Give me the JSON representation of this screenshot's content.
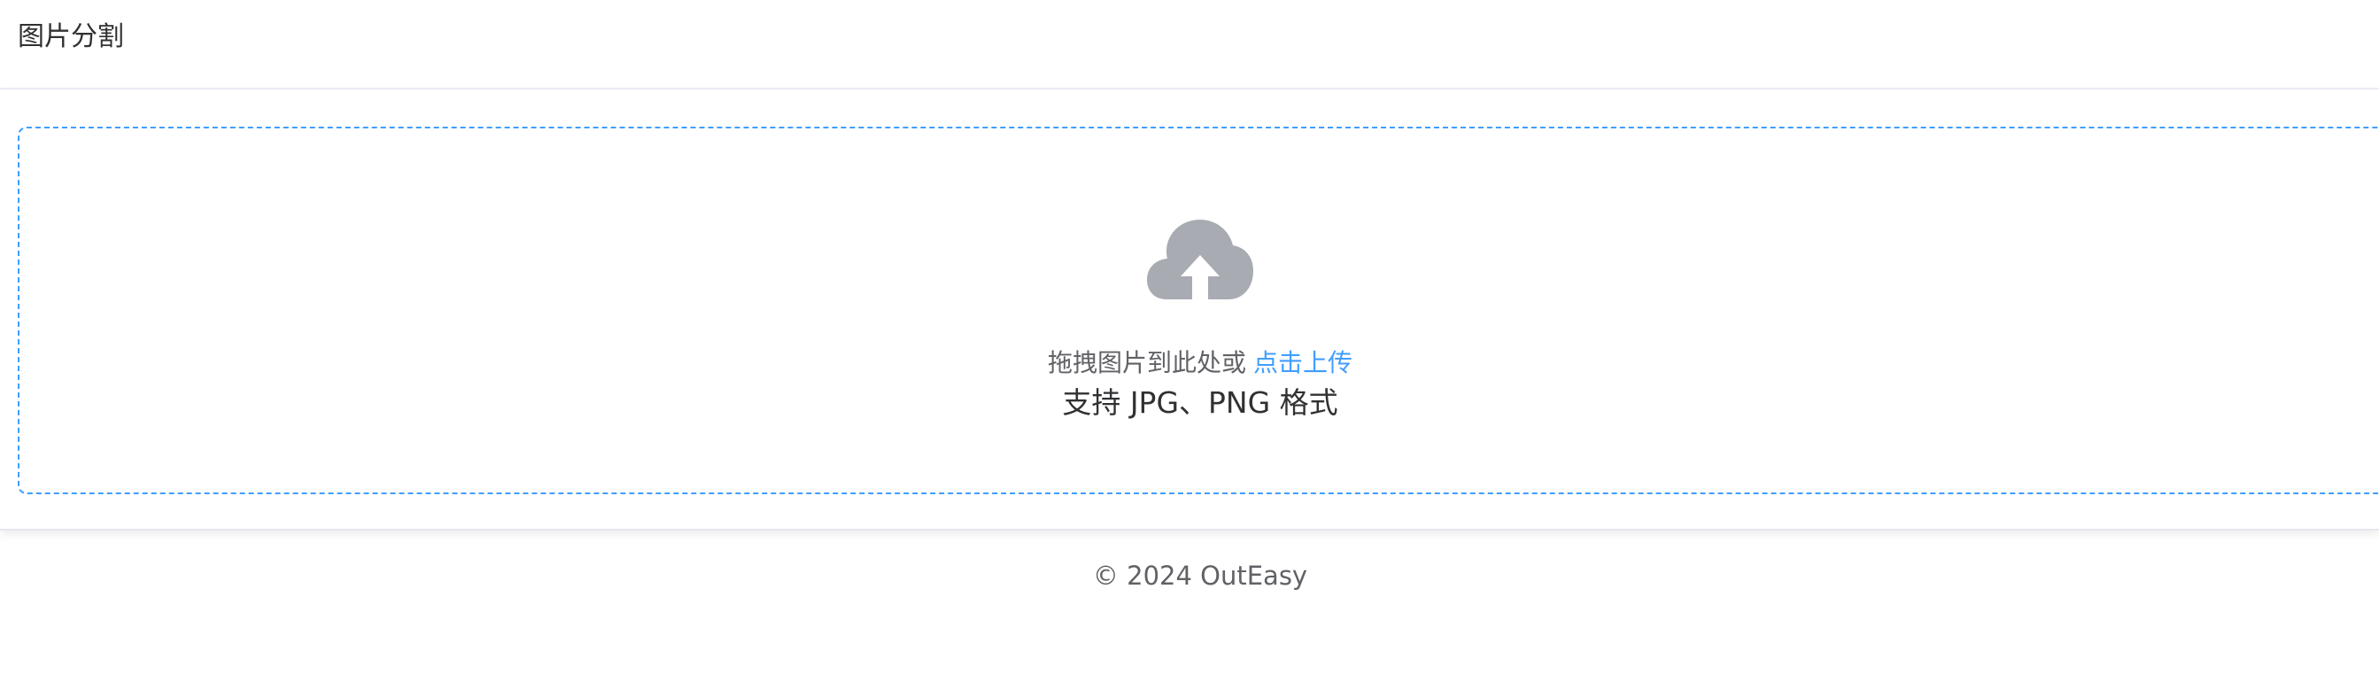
{
  "header": {
    "title": "图片分割"
  },
  "upload": {
    "icon": "cloud-upload-icon",
    "drag_text": "拖拽图片到此处或",
    "click_text": "点击上传",
    "tip": "支持 JPG、PNG 格式"
  },
  "footer": {
    "copyright": "© 2024 OutEasy"
  },
  "colors": {
    "accent": "#409eff",
    "icon_gray": "#a8abb2",
    "text_primary": "#303133",
    "text_regular": "#606266",
    "border": "#ebeef5"
  }
}
